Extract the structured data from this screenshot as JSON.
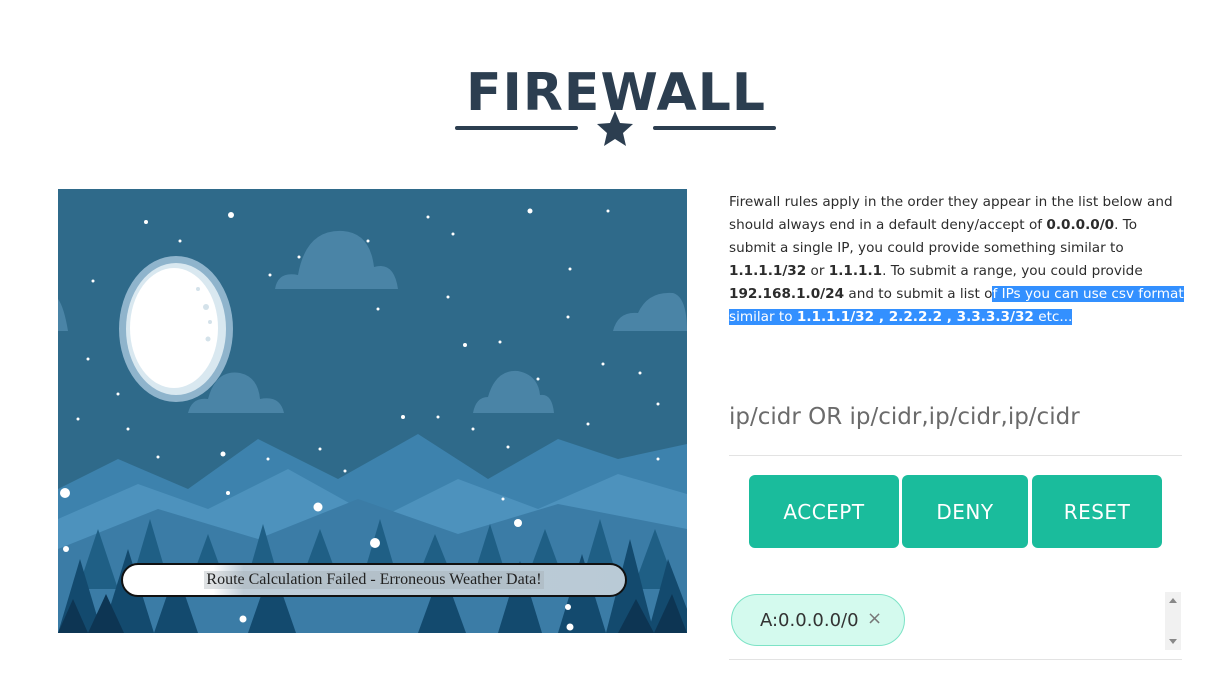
{
  "header": {
    "title": "FIREWALL",
    "divider_icon": "star-icon"
  },
  "scene": {
    "route_status": "Route Calculation Failed - Erroneous Weather Data!"
  },
  "description": {
    "part1": "Firewall rules apply in the order they appear in the list below and should always end in a default deny/accept of ",
    "default_cidr": "0.0.0.0/0",
    "part2": ". To submit a single IP, you could provide something similar to ",
    "single_ip_cidr": "1.1.1.1/32",
    "part3": " or ",
    "single_ip": "1.1.1.1",
    "part4": ". To submit a range, you could provide ",
    "range_cidr": "192.168.1.0/24",
    "part5": " and to submit a list o",
    "part6_selected": "f IPs you can use csv format similar to ",
    "list_example": "1.1.1.1/32 , 2.2.2.2 , 3.3.3.3/32",
    "part7_selected": " etc..."
  },
  "input": {
    "placeholder": "ip/cidr OR ip/cidr,ip/cidr,ip/cidr",
    "value": ""
  },
  "buttons": {
    "accept": "ACCEPT",
    "deny": "DENY",
    "reset": "RESET"
  },
  "rules": [
    {
      "label": "A:0.0.0.0/0",
      "remove_icon": "close-icon",
      "remove_glyph": "×"
    }
  ],
  "colors": {
    "title": "#2c3e50",
    "accent": "#1abc9c",
    "chip_bg": "#d4faee",
    "chip_border": "#7de3c6",
    "selection": "#3390ff"
  }
}
